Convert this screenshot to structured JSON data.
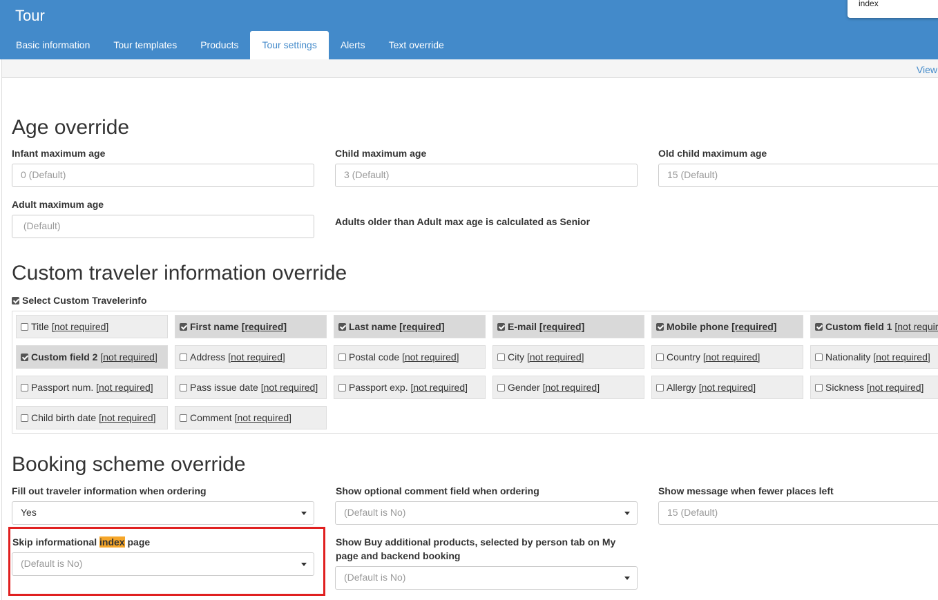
{
  "app": {
    "title": "Tour"
  },
  "find_popup": {
    "text": "index"
  },
  "tabs": [
    {
      "label": "Basic information",
      "active": false
    },
    {
      "label": "Tour templates",
      "active": false
    },
    {
      "label": "Products",
      "active": false
    },
    {
      "label": "Tour settings",
      "active": true
    },
    {
      "label": "Alerts",
      "active": false
    },
    {
      "label": "Text override",
      "active": false
    }
  ],
  "subbar": {
    "view_link": "View"
  },
  "age_override": {
    "heading": "Age override",
    "infant": {
      "label": "Infant maximum age",
      "placeholder": "0 (Default)"
    },
    "child": {
      "label": "Child maximum age",
      "placeholder": "3 (Default)"
    },
    "old_child": {
      "label": "Old child maximum age",
      "placeholder": "15 (Default)"
    },
    "adult": {
      "label": "Adult maximum age",
      "placeholder": " (Default)"
    },
    "note": "Adults older than Adult max age is calculated as Senior"
  },
  "custom_traveler": {
    "heading": "Custom traveler information override",
    "select_label": "Select Custom Travelerinfo",
    "fields": [
      {
        "name": "Title",
        "req": "[not required]",
        "checked": false
      },
      {
        "name": "First name",
        "req": "[required]",
        "checked": true
      },
      {
        "name": "Last name",
        "req": "[required]",
        "checked": true
      },
      {
        "name": "E-mail",
        "req": "[required]",
        "checked": true
      },
      {
        "name": "Mobile phone",
        "req": "[required]",
        "checked": true
      },
      {
        "name": "Custom field 1",
        "req": "[not required]",
        "checked": true
      },
      {
        "name": "Custom field 2",
        "req": "[not required]",
        "checked": true
      },
      {
        "name": "Address",
        "req": "[not required]",
        "checked": false
      },
      {
        "name": "Postal code",
        "req": "[not required]",
        "checked": false
      },
      {
        "name": "City",
        "req": "[not required]",
        "checked": false
      },
      {
        "name": "Country",
        "req": "[not required]",
        "checked": false
      },
      {
        "name": "Nationality",
        "req": "[not required]",
        "checked": false
      },
      {
        "name": "Passport num.",
        "req": "[not required]",
        "checked": false
      },
      {
        "name": "Pass issue date",
        "req": "[not required]",
        "checked": false
      },
      {
        "name": "Passport exp.",
        "req": "[not required]",
        "checked": false
      },
      {
        "name": "Gender",
        "req": "[not required]",
        "checked": false
      },
      {
        "name": "Allergy",
        "req": "[not required]",
        "checked": false
      },
      {
        "name": "Sickness",
        "req": "[not required]",
        "checked": false
      },
      {
        "name": "Child birth date",
        "req": "[not required]",
        "checked": false
      },
      {
        "name": "Comment",
        "req": "[not required]",
        "checked": false
      }
    ]
  },
  "booking_scheme": {
    "heading": "Booking scheme override",
    "fill_out": {
      "label": "Fill out traveler information when ordering",
      "value": "Yes"
    },
    "optional_comment": {
      "label": "Show optional comment field when ordering",
      "value": "(Default is No)"
    },
    "fewer_places": {
      "label": "Show message when fewer places left",
      "placeholder": "15 (Default)"
    },
    "skip_index": {
      "label_before": "Skip informational ",
      "label_highlight": "index",
      "label_after": " page",
      "value": "(Default is No)"
    },
    "buy_additional": {
      "label_line1": "Show Buy additional products, selected by person tab on My",
      "label_line2": "page and backend booking",
      "value": "(Default is No)"
    }
  },
  "colors": {
    "header": "#438ACA",
    "highlight": "#f5a62a",
    "annotation_border": "#e02020"
  }
}
